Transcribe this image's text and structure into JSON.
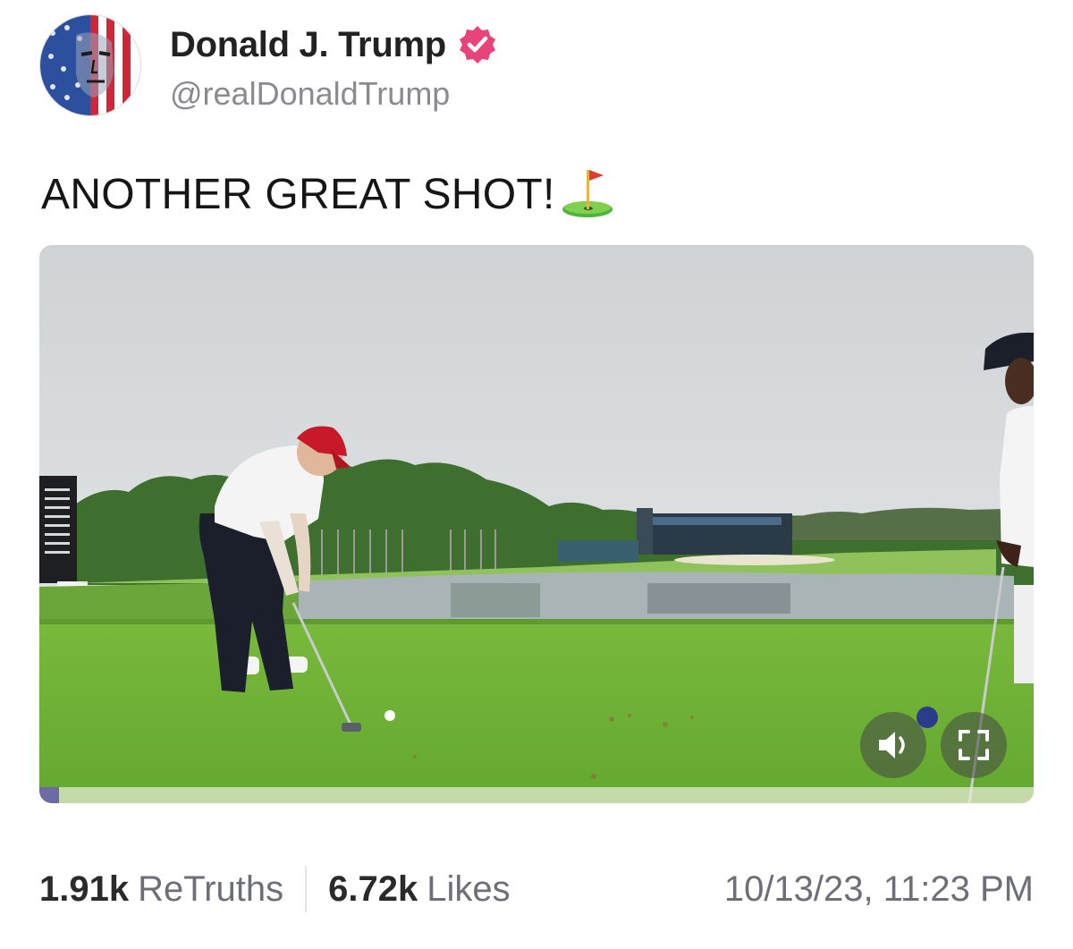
{
  "author": {
    "display_name": "Donald J. Trump",
    "handle": "@realDonaldTrump",
    "avatar_icon": "flag-face-avatar",
    "verified_icon": "verified-badge-icon",
    "verified_color": "#e8447a"
  },
  "post": {
    "text": "ANOTHER GREAT SHOT!",
    "emoji_icon": "golf-flag-icon"
  },
  "video": {
    "description_icon": "golf-course-video",
    "mute_icon": "speaker-icon",
    "fullscreen_icon": "fullscreen-icon",
    "progress_fraction": 0.02,
    "progress_color": "#6e6aa6"
  },
  "stats": {
    "retruths_count": "1.91k",
    "retruths_label": "ReTruths",
    "likes_count": "6.72k",
    "likes_label": "Likes",
    "timestamp": "10/13/23, 11:23 PM"
  }
}
